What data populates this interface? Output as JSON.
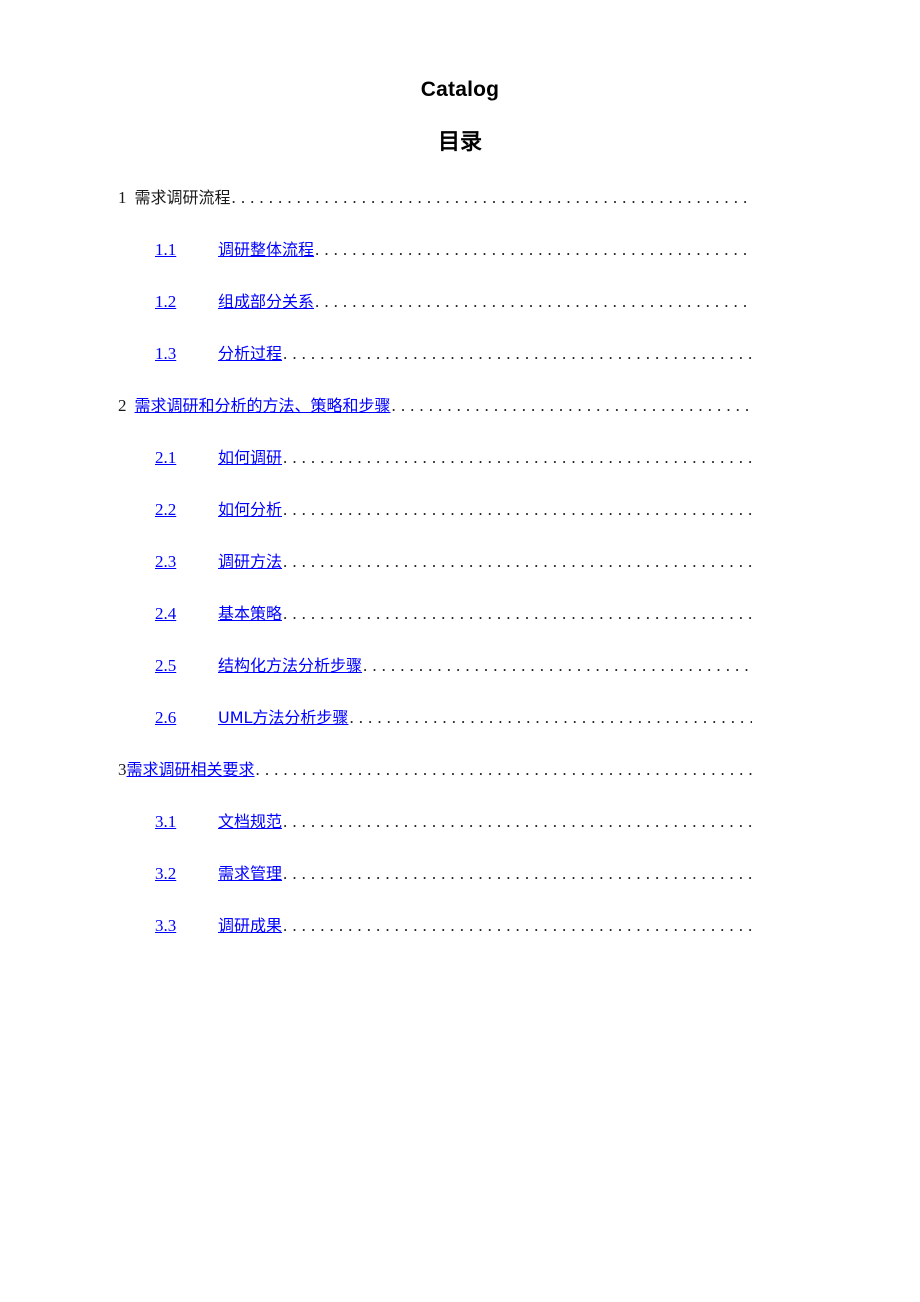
{
  "document": {
    "heading_en": "Catalog",
    "heading_cn": "目录"
  },
  "toc": {
    "entries": [
      {
        "level": 1,
        "number": "1",
        "label": "需求调研流程",
        "style": "plain",
        "number_style": "plain",
        "spaced": true
      },
      {
        "level": 2,
        "number": "1.1",
        "label": "调研整体流程",
        "style": "link",
        "number_style": "link"
      },
      {
        "level": 2,
        "number": "1.2",
        "label": "组成部分关系",
        "style": "link",
        "number_style": "link"
      },
      {
        "level": 2,
        "number": "1.3",
        "label": "分析过程",
        "style": "link",
        "number_style": "link"
      },
      {
        "level": 1,
        "number": "2",
        "label": "需求调研和分析的方法、策略和步骤",
        "style": "link",
        "number_style": "plain",
        "spaced": true
      },
      {
        "level": 2,
        "number": "2.1",
        "label": "如何调研",
        "style": "link",
        "number_style": "link"
      },
      {
        "level": 2,
        "number": "2.2",
        "label": "如何分析",
        "style": "link",
        "number_style": "link"
      },
      {
        "level": 2,
        "number": "2.3",
        "label": "调研方法",
        "style": "link",
        "number_style": "link"
      },
      {
        "level": 2,
        "number": "2.4",
        "label": "基本策略",
        "style": "link",
        "number_style": "link"
      },
      {
        "level": 2,
        "number": "2.5",
        "label": "结构化方法分析步骤",
        "style": "link",
        "number_style": "link"
      },
      {
        "level": 2,
        "number": "2.6",
        "label": "UML方法分析步骤",
        "style": "link",
        "number_style": "link"
      },
      {
        "level": 1,
        "number": "3",
        "label": "需求调研相关要求",
        "style": "link",
        "number_style": "blue",
        "spaced": false
      },
      {
        "level": 2,
        "number": "3.1",
        "label": "文档规范",
        "style": "link",
        "number_style": "link"
      },
      {
        "level": 2,
        "number": "3.2",
        "label": "需求管理",
        "style": "link",
        "number_style": "link"
      },
      {
        "level": 2,
        "number": "3.3",
        "label": "调研成果",
        "style": "link",
        "number_style": "link"
      }
    ]
  },
  "colors": {
    "link": "#0000ff",
    "text": "#1a1a1a",
    "background": "#ffffff"
  }
}
